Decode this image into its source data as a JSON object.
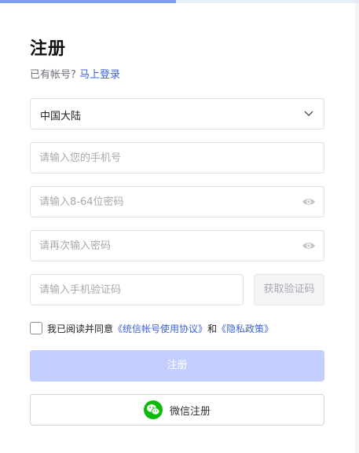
{
  "progress": {
    "fraction": 0.49,
    "color": "#7f9cf3"
  },
  "header": {
    "title": "注册",
    "have_account": "已有帐号?",
    "login_link": "马上登录"
  },
  "form": {
    "region": {
      "selected": "中国大陆"
    },
    "phone": {
      "placeholder": "请输入您的手机号",
      "value": ""
    },
    "password": {
      "placeholder": "请输入8-64位密码",
      "value": ""
    },
    "confirm_password": {
      "placeholder": "请再次输入密码",
      "value": ""
    },
    "sms_code": {
      "placeholder": "请输入手机验证码",
      "value": ""
    },
    "get_code_label": "获取验证码",
    "agreement": {
      "checked": false,
      "prefix": "我已阅读并同意",
      "terms_link": "《统信帐号使用协议》",
      "joiner": "和",
      "privacy_link": "《隐私政策》"
    },
    "submit_label": "注册",
    "wechat_label": "微信注册"
  },
  "colors": {
    "accent": "#3a62d8",
    "submit_disabled": "#c3cefc",
    "wechat_green": "#09bb07"
  },
  "icons": [
    "chevron-down-icon",
    "eye-icon",
    "wechat-icon"
  ]
}
